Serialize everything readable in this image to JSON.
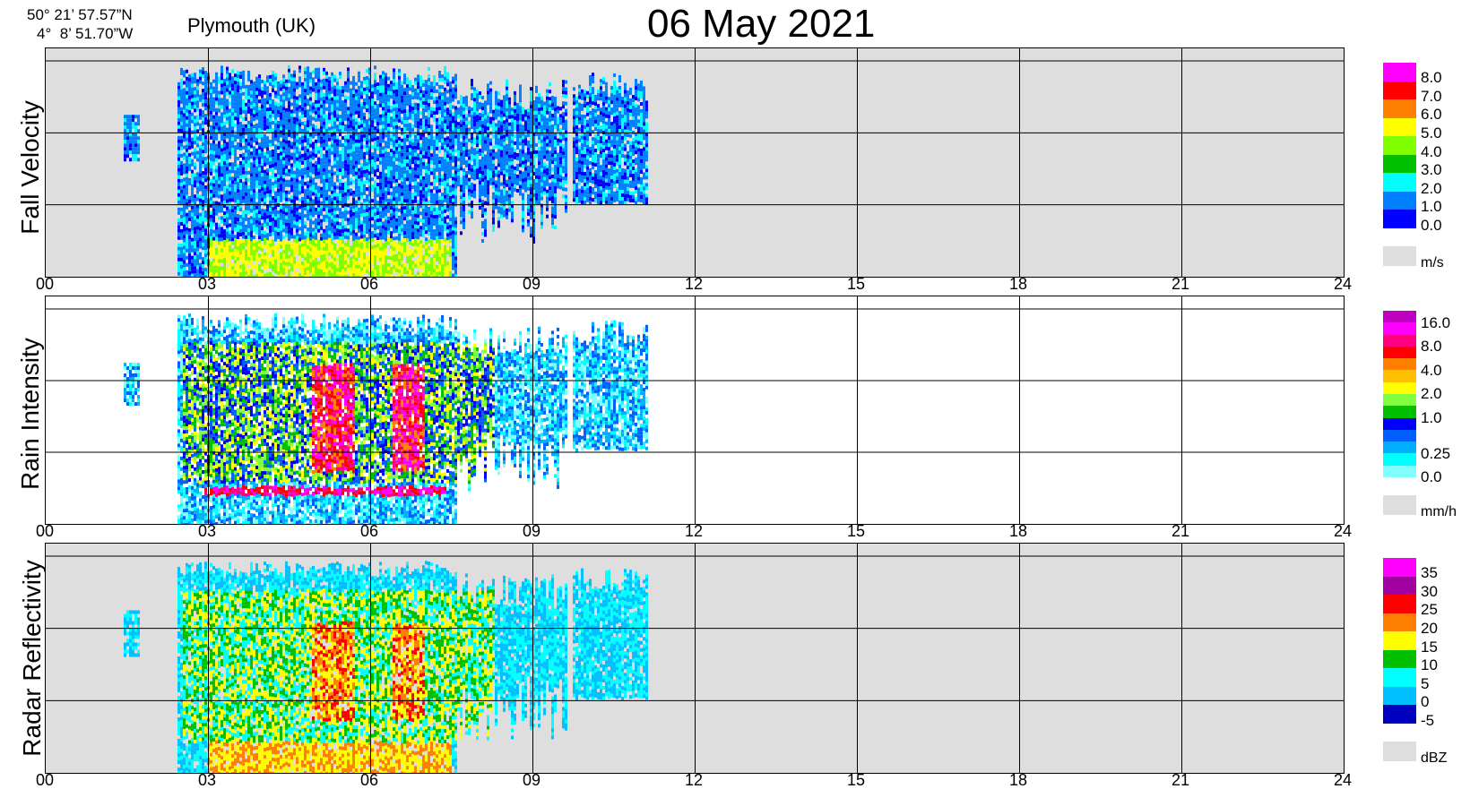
{
  "header": {
    "lat": "50° 21’ 57.57”N",
    "lon": "4°  8’ 51.70”W",
    "station": "Plymouth (UK)",
    "date": "06 May  2021"
  },
  "x_ticks": [
    "00",
    "03",
    "06",
    "09",
    "12",
    "15",
    "18",
    "21",
    "24"
  ],
  "panels": [
    {
      "label": "Fall Velocity",
      "unit": "m/s",
      "background": "#dedede",
      "colorbar": [
        {
          "label": "8.0",
          "color": "#ff00ff"
        },
        {
          "label": "7.0",
          "color": "#ff0000"
        },
        {
          "label": "6.0",
          "color": "#ff8000"
        },
        {
          "label": "5.0",
          "color": "#ffff00"
        },
        {
          "label": "4.0",
          "color": "#80ff00"
        },
        {
          "label": "3.0",
          "color": "#00c000"
        },
        {
          "label": "2.0",
          "color": "#00ffff"
        },
        {
          "label": "1.0",
          "color": "#0080ff"
        },
        {
          "label": "0.0",
          "color": "#0000ff"
        }
      ]
    },
    {
      "label": "Rain Intensity",
      "unit": "mm/h",
      "background": "#ffffff",
      "colorbar": [
        {
          "label": "16.0",
          "color": "#c000c0"
        },
        {
          "label": "",
          "color": "#ff00ff"
        },
        {
          "label": "8.0",
          "color": "#ff0080"
        },
        {
          "label": "",
          "color": "#ff0000"
        },
        {
          "label": "4.0",
          "color": "#ff8000"
        },
        {
          "label": "",
          "color": "#ffc000"
        },
        {
          "label": "2.0",
          "color": "#ffff00"
        },
        {
          "label": "",
          "color": "#80ff40"
        },
        {
          "label": "1.0",
          "color": "#00c000"
        },
        {
          "label": "",
          "color": "#0000ff"
        },
        {
          "label": "",
          "color": "#0060ff"
        },
        {
          "label": "0.25",
          "color": "#00b0ff"
        },
        {
          "label": "",
          "color": "#00ffff"
        },
        {
          "label": "0.0",
          "color": "#80ffff"
        }
      ]
    },
    {
      "label": "Radar Reflectivity",
      "unit": "dBZ",
      "background": "#dedede",
      "colorbar": [
        {
          "label": "35",
          "color": "#ff00ff"
        },
        {
          "label": "30",
          "color": "#a000a0"
        },
        {
          "label": "25",
          "color": "#ff0000"
        },
        {
          "label": "20",
          "color": "#ff8000"
        },
        {
          "label": "15",
          "color": "#ffff00"
        },
        {
          "label": "10",
          "color": "#00c000"
        },
        {
          "label": "5",
          "color": "#00ffff"
        },
        {
          "label": "0",
          "color": "#00c0ff"
        },
        {
          "label": "-5",
          "color": "#0000c0"
        }
      ]
    }
  ],
  "chart_data": [
    {
      "type": "heatmap",
      "title": "Fall Velocity",
      "x_unit": "hour (UTC)",
      "xlim": [
        0,
        24
      ],
      "colorbar_unit": "m/s",
      "colorbar_levels": [
        0.0,
        1.0,
        2.0,
        3.0,
        4.0,
        5.0,
        6.0,
        7.0,
        8.0
      ],
      "echo_periods_hours": [
        [
          1.4,
          1.7
        ],
        [
          2.4,
          7.6
        ],
        [
          7.6,
          9.6
        ],
        [
          9.7,
          11.1
        ]
      ],
      "surface_band_hours": [
        3.0,
        7.5
      ],
      "surface_band_fall_velocity_ms": [
        4.0,
        5.5
      ]
    },
    {
      "type": "heatmap",
      "title": "Rain Intensity",
      "x_unit": "hour (UTC)",
      "xlim": [
        0,
        24
      ],
      "colorbar_unit": "mm/h",
      "colorbar_levels": [
        0.0,
        0.25,
        1.0,
        2.0,
        4.0,
        8.0,
        16.0
      ],
      "echo_periods_hours": [
        [
          1.4,
          1.7
        ],
        [
          2.4,
          7.6
        ],
        [
          7.6,
          9.6
        ],
        [
          9.7,
          11.1
        ]
      ],
      "peak_intensity_periods_hours": [
        [
          4.9,
          5.7
        ],
        [
          6.4,
          7.0
        ]
      ]
    },
    {
      "type": "heatmap",
      "title": "Radar Reflectivity",
      "x_unit": "hour (UTC)",
      "xlim": [
        0,
        24
      ],
      "colorbar_unit": "dBZ",
      "colorbar_levels": [
        -5,
        0,
        5,
        10,
        15,
        20,
        25,
        30,
        35
      ],
      "echo_periods_hours": [
        [
          1.4,
          1.7
        ],
        [
          2.4,
          7.6
        ],
        [
          7.6,
          9.6
        ],
        [
          9.7,
          11.1
        ]
      ],
      "peak_reflectivity_dbz": 25
    }
  ]
}
